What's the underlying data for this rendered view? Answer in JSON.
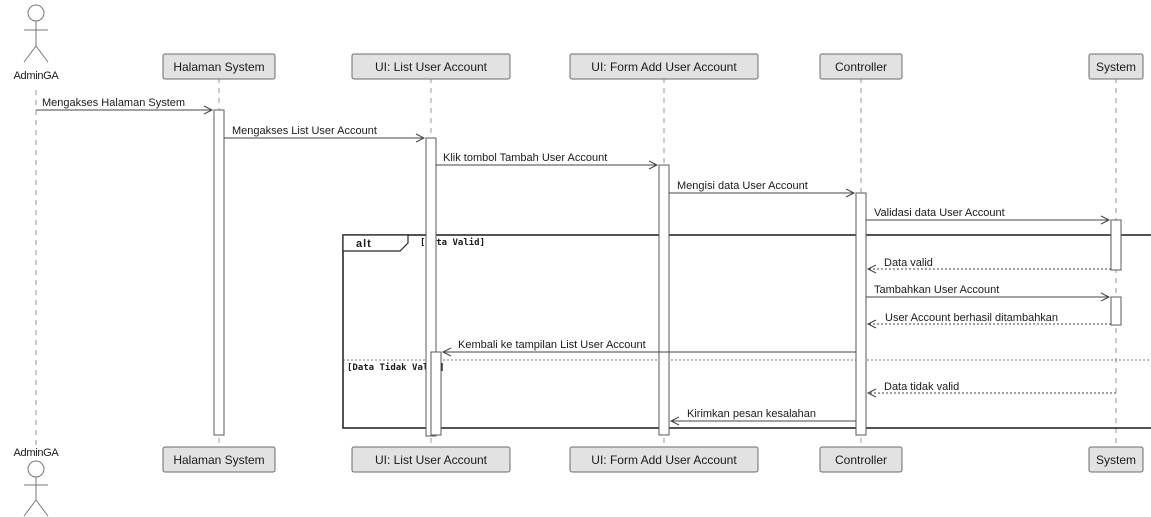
{
  "actor": {
    "name": "AdminGA"
  },
  "participants": [
    {
      "id": "halaman",
      "label": "Halaman System"
    },
    {
      "id": "list",
      "label": "UI: List User Account"
    },
    {
      "id": "form",
      "label": "UI: Form Add User Account"
    },
    {
      "id": "controller",
      "label": "Controller"
    },
    {
      "id": "system",
      "label": "System"
    }
  ],
  "messages": [
    {
      "text": "Mengakses Halaman System",
      "style": "solid"
    },
    {
      "text": "Mengakses List User Account",
      "style": "solid"
    },
    {
      "text": "Klik tombol Tambah User Account",
      "style": "solid"
    },
    {
      "text": "Mengisi data User Account",
      "style": "solid"
    },
    {
      "text": "Validasi data User Account",
      "style": "solid"
    },
    {
      "text": "Data valid",
      "style": "dashed"
    },
    {
      "text": "Tambahkan User Account",
      "style": "solid"
    },
    {
      "text": "User Account berhasil ditambahkan",
      "style": "dashed"
    },
    {
      "text": "Kembali ke tampilan List User Account",
      "style": "solid"
    },
    {
      "text": "Data tidak valid",
      "style": "dashed"
    },
    {
      "text": "Kirimkan pesan kesalahan",
      "style": "solid"
    }
  ],
  "fragment": {
    "operator": "alt",
    "guard1": "[Data Valid]",
    "guard2": "[Data Tidak Valid]"
  }
}
